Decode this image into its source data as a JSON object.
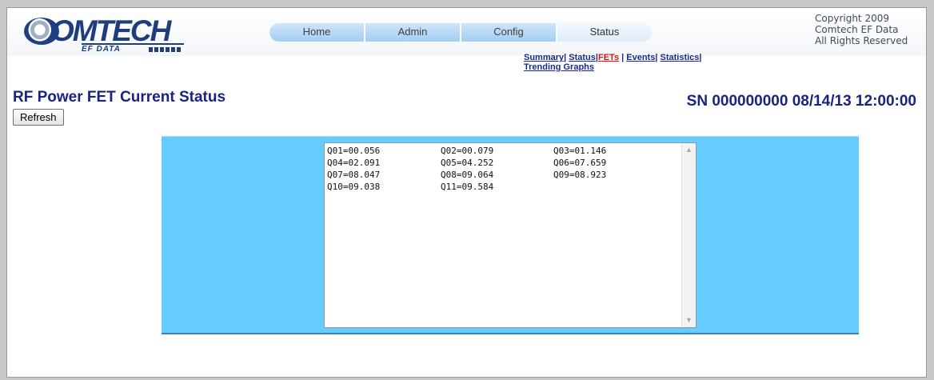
{
  "logo": {
    "word": "OMTECH",
    "sub": "EF DATA"
  },
  "nav": {
    "tabs": [
      "Home",
      "Admin",
      "Config",
      "Status"
    ],
    "active": "Status"
  },
  "subnav": {
    "summary": "Summary",
    "status": "Status",
    "fets": "FETs",
    "events": "Events",
    "statistics": "Statistics",
    "trending": "Trending Graphs"
  },
  "copyright": {
    "line1": "Copyright 2009",
    "line2": "Comtech EF Data",
    "line3": "All Rights Reserved"
  },
  "page": {
    "title": "RF Power FET Current Status",
    "sn": "SN 000000000 08/14/13 12:00:00",
    "refresh_label": "Refresh"
  },
  "fets": [
    "Q01=00.056",
    "Q02=00.079",
    "Q03=01.146",
    "Q04=02.091",
    "Q05=04.252",
    "Q06=07.659",
    "Q07=08.047",
    "Q08=09.064",
    "Q09=08.923",
    "Q10=09.038",
    "Q11=09.584"
  ],
  "colors": {
    "panel": "#66ccff",
    "title": "#1a237e",
    "link": "#1a2a8c",
    "current_link": "#e01010"
  },
  "icons": {
    "scroll_up": "scroll-up-arrow-icon",
    "scroll_down": "scroll-down-arrow-icon"
  }
}
